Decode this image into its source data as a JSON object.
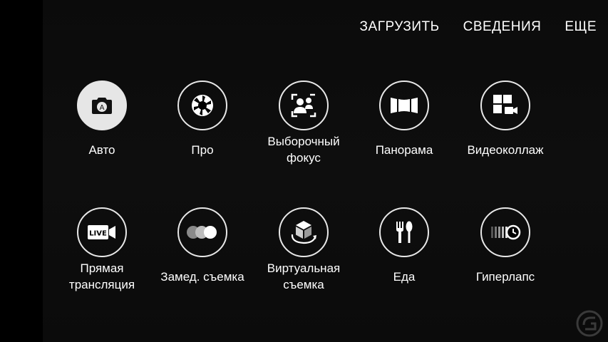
{
  "topbar": {
    "download": "ЗАГРУЗИТЬ",
    "info": "СВЕДЕНИЯ",
    "more": "ЕЩЕ"
  },
  "modes": [
    {
      "label": "Авто",
      "icon": "camera-auto-icon",
      "selected": true
    },
    {
      "label": "Про",
      "icon": "aperture-icon"
    },
    {
      "label": "Выборочный\nфокус",
      "icon": "selective-focus-icon"
    },
    {
      "label": "Панорама",
      "icon": "panorama-icon"
    },
    {
      "label": "Видеоколлаж",
      "icon": "video-collage-icon"
    },
    {
      "label": "Прямая\nтрансляция",
      "icon": "live-broadcast-icon",
      "badge": "LIVE"
    },
    {
      "label": "Замед. съемка",
      "icon": "slow-motion-icon"
    },
    {
      "label": "Виртуальная\nсъемка",
      "icon": "virtual-shot-icon"
    },
    {
      "label": "Еда",
      "icon": "food-icon"
    },
    {
      "label": "Гиперлапс",
      "icon": "hyperlapse-icon"
    }
  ],
  "colors": {
    "background": "#000000",
    "panel": "#0d0d0d",
    "ring": "#e8e8e8",
    "selected_fill": "#e6e6e6",
    "text": "#ffffff"
  }
}
